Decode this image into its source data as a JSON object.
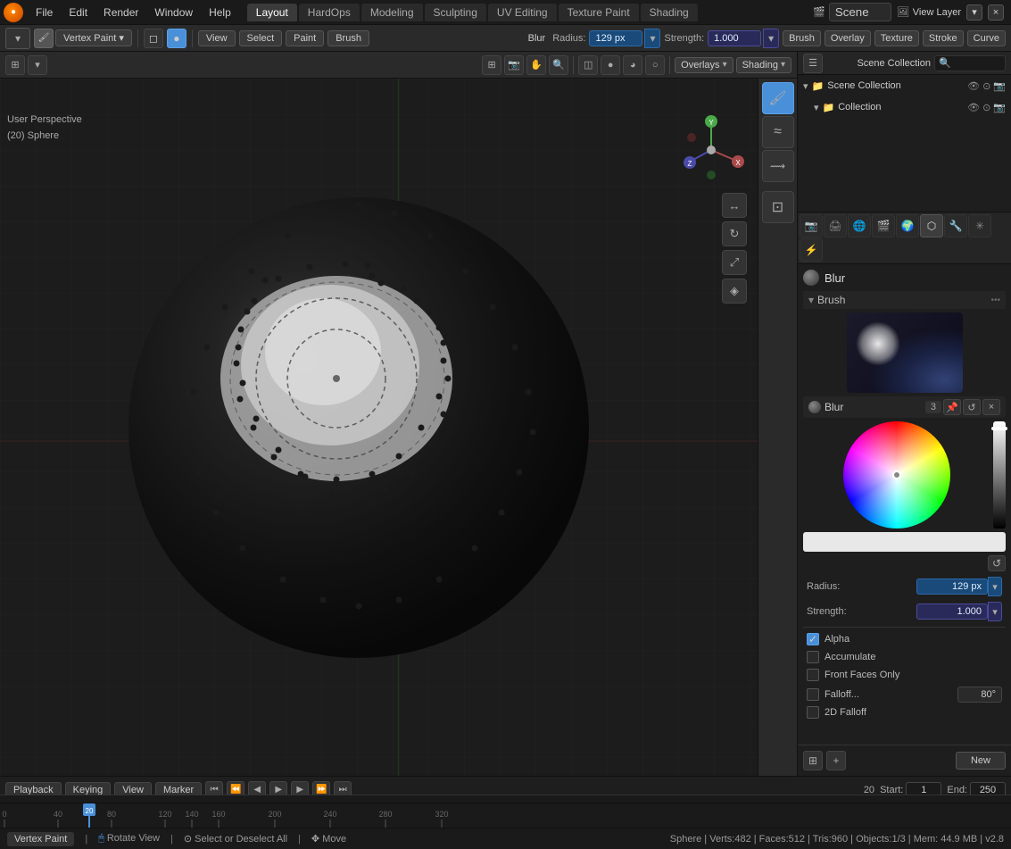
{
  "app": {
    "name": "Blender",
    "version": "v2.8"
  },
  "topMenu": {
    "items": [
      "File",
      "Edit",
      "Render",
      "Window",
      "Help"
    ]
  },
  "workspaceTabs": [
    {
      "label": "Layout",
      "active": true
    },
    {
      "label": "HardOps"
    },
    {
      "label": "Modeling"
    },
    {
      "label": "Sculpting"
    },
    {
      "label": "UV Editing"
    },
    {
      "label": "Texture Paint"
    },
    {
      "label": "Shading"
    }
  ],
  "sceneArea": {
    "engineLabel": "Scene",
    "viewLayerLabel": "View Layer"
  },
  "toolbar": {
    "brushName": "Blur",
    "radiusLabel": "Radius:",
    "radiusValue": "129 px",
    "strengthLabel": "Strength:",
    "strengthValue": "1.000",
    "dropdowns": [
      "Brush",
      "Overlay",
      "Texture",
      "Stroke",
      "Curve"
    ]
  },
  "viewportHeader": {
    "modeButtons": [
      "View",
      "Select",
      "Paint",
      "Brush"
    ],
    "activeMode": "Vertex Paint",
    "overlaysBtn": "Overlays",
    "shadingBtn": "Shading"
  },
  "viewportInfo": {
    "perspective": "User Perspective",
    "object": "(20) Sphere"
  },
  "outliner": {
    "title": "Scene Collection",
    "items": [
      {
        "label": "Collection",
        "indent": true
      }
    ]
  },
  "brushPanel": {
    "name": "Blur",
    "sectionLabel": "Brush",
    "selectorName": "Blur",
    "selectorNum": "3",
    "radiusLabel": "Radius:",
    "radiusValue": "129 px",
    "strengthLabel": "Strength:",
    "strengthValue": "1.000",
    "checkboxes": [
      {
        "label": "Alpha",
        "checked": true
      },
      {
        "label": "Accumulate",
        "checked": false
      },
      {
        "label": "Front Faces Only",
        "checked": false
      },
      {
        "label": "Falloff...",
        "checked": false,
        "value": "80°"
      },
      {
        "label": "2D Falloff",
        "checked": false
      }
    ]
  },
  "timeline": {
    "playbackLabel": "Playback",
    "keyingLabel": "Keying",
    "viewLabel": "View",
    "markerLabel": "Marker",
    "currentFrame": "20",
    "startLabel": "Start:",
    "startFrame": "1",
    "endLabel": "End:",
    "endFrame": "250",
    "ticks": [
      "0",
      "40",
      "80",
      "120",
      "140",
      "160",
      "200",
      "240",
      "280",
      "320"
    ]
  },
  "newButton": {
    "label": "New"
  },
  "statusBar": {
    "mode": "Vertex Paint",
    "rotate": "Rotate View",
    "selectAll": "Select or Deselect All",
    "move": "Move",
    "stats": "Sphere | Verts:482 | Faces:512 | Tris:960 | Objects:1/3 | Mem: 44.9 MB | v2.8",
    "tris": "Tris 960"
  },
  "icons": {
    "arrow_down": "▾",
    "arrow_right": "▸",
    "dot": "●",
    "check": "✓",
    "sphere": "○",
    "eye": "👁",
    "camera": "📷",
    "brush": "🖌",
    "paint_bucket": "🪣",
    "cursor": "⊕",
    "move": "✥",
    "rotate": "↻",
    "scale": "⤢",
    "transform": "⊞",
    "annotate": "✏",
    "select_box": "□",
    "grid": "⊞",
    "close": "×"
  },
  "colors": {
    "accent": "#4a90d9",
    "background": "#1c1c1c",
    "panel": "#1e1e1e",
    "header": "#252525",
    "active_tool": "#4a90d9",
    "xaxis": "#aa3333",
    "yaxis": "#33aa33",
    "zaxis": "#3333aa"
  }
}
